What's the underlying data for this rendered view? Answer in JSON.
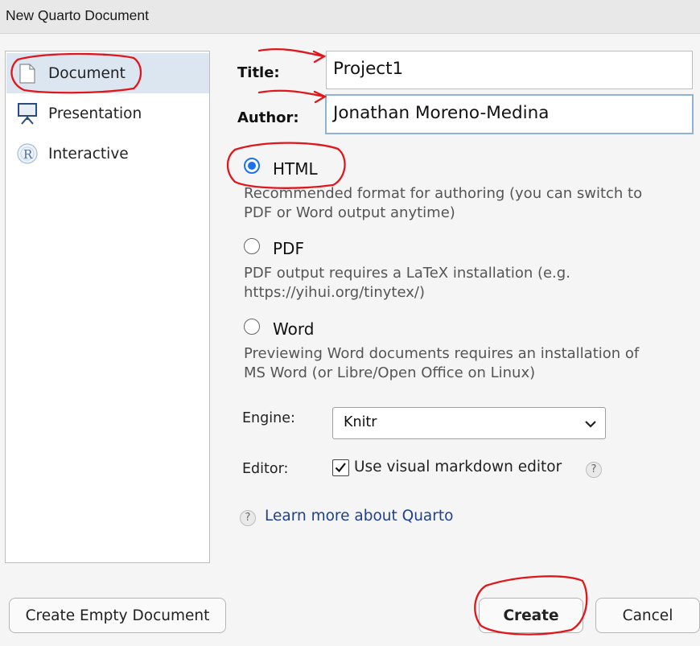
{
  "window": {
    "title": "New Quarto Document"
  },
  "sidebar": {
    "items": [
      {
        "label": "Document",
        "icon": "document-icon",
        "selected": true
      },
      {
        "label": "Presentation",
        "icon": "presentation-easel-icon",
        "selected": false
      },
      {
        "label": "Interactive",
        "icon": "r-logo-icon",
        "selected": false
      }
    ]
  },
  "form": {
    "title_label": "Title:",
    "title_value": "Project1",
    "author_label": "Author:",
    "author_value": "Jonathan Moreno-Medina"
  },
  "formats": [
    {
      "label": "HTML",
      "checked": true,
      "description_line1": "Recommended format for authoring (you can switch to",
      "description_line2": "PDF or Word output anytime)"
    },
    {
      "label": "PDF",
      "checked": false,
      "description_line1": "PDF output requires a LaTeX installation (e.g.",
      "description_line2": "https://yihui.org/tinytex/)"
    },
    {
      "label": "Word",
      "checked": false,
      "description_line1": "Previewing Word documents requires an installation of",
      "description_line2": "MS Word (or Libre/Open Office on Linux)"
    }
  ],
  "engine": {
    "label": "Engine:",
    "value": "Knitr"
  },
  "editor": {
    "label": "Editor:",
    "checkbox_label": "Use visual markdown editor",
    "checked": true
  },
  "learn_more": {
    "label": "Learn more about Quarto"
  },
  "buttons": {
    "create_empty": "Create Empty Document",
    "create": "Create",
    "cancel": "Cancel"
  },
  "colors": {
    "accent": "#1a73e8",
    "selected_bg": "#dce6f0",
    "annotation": "#e0161b",
    "link": "#1f3f8f"
  }
}
